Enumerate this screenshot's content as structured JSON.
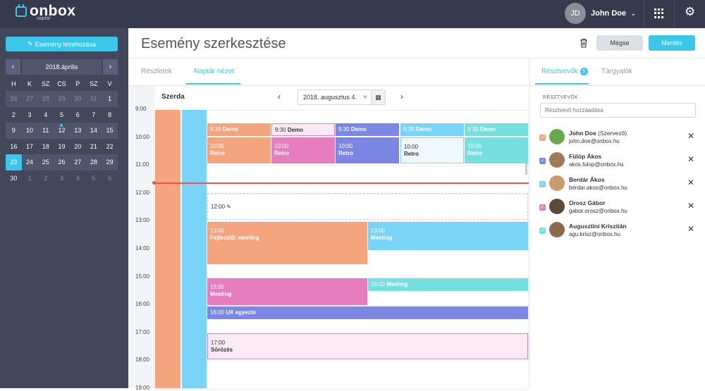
{
  "app": {
    "logo": "onbox",
    "logo_sub": "naptár"
  },
  "user": {
    "initials": "JD",
    "name": "John Doe"
  },
  "sidebar": {
    "create_label": "Esemény létrehozása",
    "month_label": "2018.április",
    "dow": [
      "H",
      "K",
      "SZ",
      "CS",
      "P",
      "SZ",
      "V"
    ],
    "weeks": [
      [
        {
          "d": "26",
          "m": 1
        },
        {
          "d": "27",
          "m": 1
        },
        {
          "d": "28",
          "m": 1
        },
        {
          "d": "29",
          "m": 1
        },
        {
          "d": "30",
          "m": 1
        },
        {
          "d": "31",
          "m": 1
        },
        {
          "d": "1"
        }
      ],
      [
        {
          "d": "2"
        },
        {
          "d": "3"
        },
        {
          "d": "4"
        },
        {
          "d": "5"
        },
        {
          "d": "6"
        },
        {
          "d": "7"
        },
        {
          "d": "8"
        }
      ],
      [
        {
          "d": "9"
        },
        {
          "d": "10"
        },
        {
          "d": "11"
        },
        {
          "d": "12",
          "dot": 1
        },
        {
          "d": "13"
        },
        {
          "d": "14"
        },
        {
          "d": "15"
        }
      ],
      [
        {
          "d": "16"
        },
        {
          "d": "17"
        },
        {
          "d": "18"
        },
        {
          "d": "19"
        },
        {
          "d": "20"
        },
        {
          "d": "21"
        },
        {
          "d": "22"
        }
      ],
      [
        {
          "d": "23",
          "sel": 1
        },
        {
          "d": "24"
        },
        {
          "d": "25"
        },
        {
          "d": "26"
        },
        {
          "d": "27"
        },
        {
          "d": "28"
        },
        {
          "d": "29"
        }
      ],
      [
        {
          "d": "30"
        },
        {
          "d": "1",
          "m": 1
        },
        {
          "d": "2",
          "m": 1
        },
        {
          "d": "3",
          "m": 1
        },
        {
          "d": "4",
          "m": 1
        },
        {
          "d": "5",
          "m": 1
        },
        {
          "d": "6",
          "m": 1
        }
      ]
    ]
  },
  "header": {
    "title": "Esemény szerkesztése",
    "cancel_label": "Mégse",
    "save_label": "Mentés"
  },
  "tabs": {
    "details": "Részletek",
    "calendar_view": "Naptár nézet"
  },
  "calendar": {
    "day_label": "Szerda",
    "date_value": "2018. augusztus 4.",
    "times": [
      "9:00",
      "10:00",
      "11:00",
      "12:00",
      "13:00",
      "14:00",
      "15:00",
      "16:00",
      "17:00",
      "18:00",
      "19:00"
    ],
    "edit_time": "12:00",
    "events": [
      {
        "id": "demo1",
        "time": "9:30",
        "title": "Demo",
        "color": "#f4a57e"
      },
      {
        "id": "demo2",
        "time": "9:30",
        "title": "Demo",
        "color": "#fbeaf3"
      },
      {
        "id": "demo3",
        "time": "9:30",
        "title": "Demo",
        "color": "#7b87e3"
      },
      {
        "id": "demo4",
        "time": "9:30",
        "title": "Demo",
        "color": "#7ad4f8"
      },
      {
        "id": "demo5",
        "time": "9:30",
        "title": "Demo",
        "color": "#76e0e0"
      },
      {
        "id": "retro1",
        "time": "10:00",
        "title": "Retro",
        "color": "#f4a57e"
      },
      {
        "id": "retro2",
        "time": "10:00",
        "title": "Retro",
        "color": "#e77dbf"
      },
      {
        "id": "retro3",
        "time": "10:00",
        "title": "Retro",
        "color": "#7b87e3"
      },
      {
        "id": "retro4",
        "time": "10:00",
        "title": "Retro",
        "color": "#eef8fd"
      },
      {
        "id": "retro5",
        "time": "10:00",
        "title": "Retro",
        "color": "#76e0e0"
      },
      {
        "id": "fejl",
        "time": "13:00",
        "title": "Fejlesztői meeting",
        "color": "#f4a57e"
      },
      {
        "id": "m13",
        "time": "13:00",
        "title": "Meeting",
        "color": "#7ad4f8"
      },
      {
        "id": "m15a",
        "time": "15:00",
        "title": "Meeting",
        "color": "#e77dbf"
      },
      {
        "id": "m15b",
        "time": "15:00",
        "title": "Meeting",
        "color": "#76e0e0"
      },
      {
        "id": "ux",
        "time": "16:00",
        "title": "UX egyezte",
        "color": "#7b87e3"
      },
      {
        "id": "sor",
        "time": "17:00",
        "title": "Sörözés",
        "color": "#fbeaf3"
      }
    ]
  },
  "participants": {
    "tab_label": "Résztvevők",
    "count": "5",
    "topics_tab": "Tárgyalók",
    "section_label": "RÉSZTVEVŐK",
    "input_placeholder": "Résztvevő hozzáadása",
    "people": [
      {
        "name": "John Doe",
        "role": "(Szervező)",
        "email": "john.doe@onbox.hu",
        "color": "#f4a57e"
      },
      {
        "name": "Fülöp Ákos",
        "role": "",
        "email": "akos.fulop@onbox.hu",
        "color": "#7b87e3"
      },
      {
        "name": "Berdár Ákos",
        "role": "",
        "email": "berdar.akos@onbox.hu",
        "color": "#7ad4f8"
      },
      {
        "name": "Orosz Gábor",
        "role": "",
        "email": "gabor.orosz@onbox.hu",
        "color": "#e77dbf"
      },
      {
        "name": "Augusztini Krisztián",
        "role": "",
        "email": "agu.krisz@onbox.hu",
        "color": "#76e0e0"
      }
    ]
  }
}
